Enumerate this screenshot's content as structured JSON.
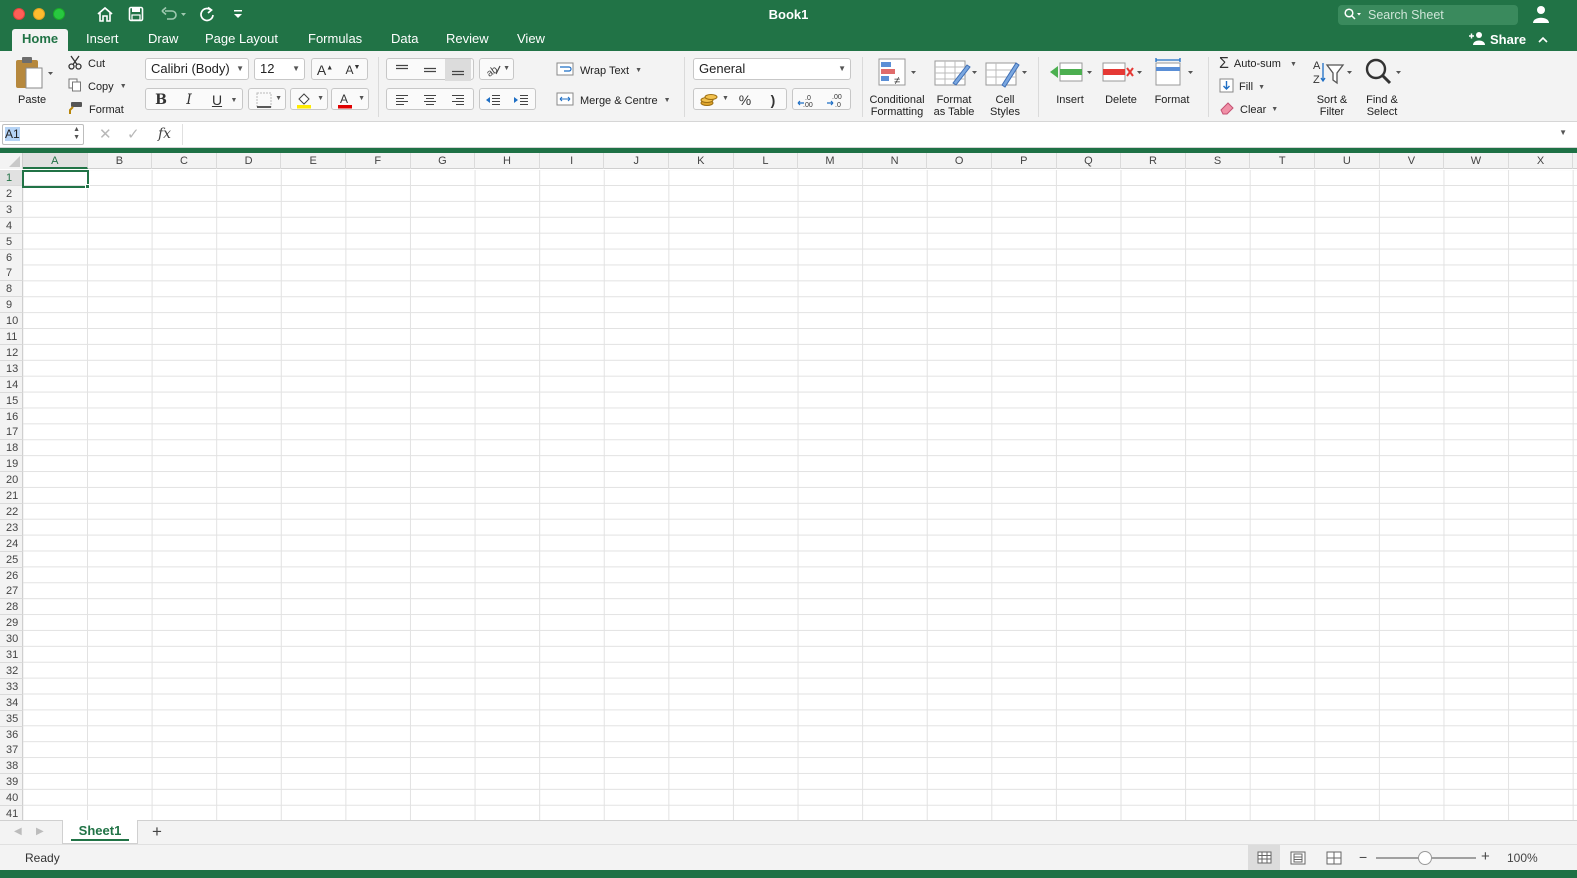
{
  "window": {
    "title": "Book1",
    "search_placeholder": "Search Sheet"
  },
  "tabs": [
    {
      "label": "Home",
      "active": true
    },
    {
      "label": "Insert"
    },
    {
      "label": "Draw"
    },
    {
      "label": "Page Layout"
    },
    {
      "label": "Formulas"
    },
    {
      "label": "Data"
    },
    {
      "label": "Review"
    },
    {
      "label": "View"
    }
  ],
  "share_label": "Share",
  "ribbon": {
    "paste_label": "Paste",
    "cut_label": "Cut",
    "copy_label": "Copy",
    "format_painter_label": "Format",
    "font_name": "Calibri (Body)",
    "font_size": "12",
    "wrap_text_label": "Wrap Text",
    "merge_label": "Merge & Centre",
    "number_format": "General",
    "percent_label": "%",
    "comma_label": ")",
    "conditional_formatting_label": [
      "Conditional",
      "Formatting"
    ],
    "format_as_table_label": [
      "Format",
      "as Table"
    ],
    "cell_styles_label": [
      "Cell",
      "Styles"
    ],
    "insert_label": "Insert",
    "delete_label": "Delete",
    "format_label": "Format",
    "autosum_label": "Auto-sum",
    "fill_label": "Fill",
    "clear_label": "Clear",
    "sort_filter_label": [
      "Sort &",
      "Filter"
    ],
    "find_select_label": [
      "Find &",
      "Select"
    ]
  },
  "formula_bar": {
    "name_box": "A1",
    "fx": "fx",
    "formula": ""
  },
  "grid": {
    "columns": [
      "A",
      "B",
      "C",
      "D",
      "E",
      "F",
      "G",
      "H",
      "I",
      "J",
      "K",
      "L",
      "M",
      "N",
      "O",
      "P",
      "Q",
      "R",
      "S",
      "T",
      "U",
      "V",
      "W",
      "X"
    ],
    "rows": [
      "1",
      "2",
      "3",
      "4",
      "5",
      "6",
      "7",
      "8",
      "9",
      "10",
      "11",
      "12",
      "13",
      "14",
      "15",
      "16",
      "17",
      "18",
      "19",
      "20",
      "21",
      "22",
      "23",
      "24",
      "25",
      "26",
      "27",
      "28",
      "29",
      "30",
      "31",
      "32",
      "33",
      "34",
      "35",
      "36",
      "37",
      "38",
      "39",
      "40",
      "41"
    ],
    "active_cell": "A1"
  },
  "sheets": [
    {
      "label": "Sheet1",
      "active": true
    }
  ],
  "add_sheet_label": "+",
  "status": {
    "text": "Ready",
    "zoom": "100%",
    "zoom_minus": "−",
    "zoom_plus": "+"
  },
  "colors": {
    "accent": "#217346",
    "titlebar": "#217346"
  }
}
